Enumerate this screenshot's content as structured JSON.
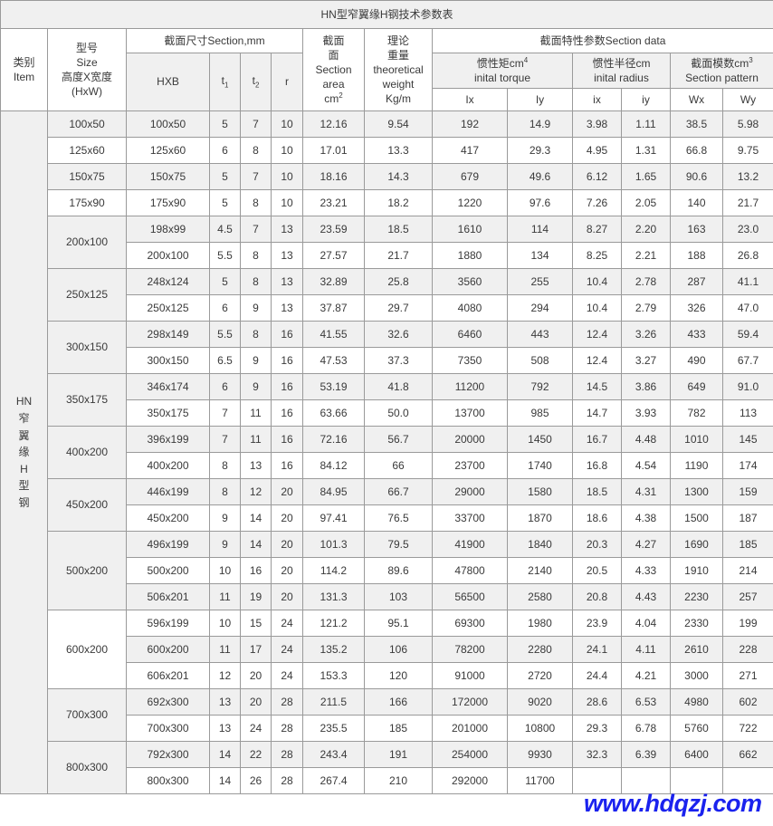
{
  "title": "HN型窄翼缘H钢技术参数表",
  "watermark": "www.hdqzj.com",
  "header": {
    "item_cn": "类别",
    "item_en": "Item",
    "size_cn": "型号",
    "size_en": "Size",
    "size_cn2": "高度X宽度",
    "size_en2": "(HxW)",
    "section_dims": "截面尺寸Section,mm",
    "hxb": "HXB",
    "t1_base": "t",
    "t1_sub": "1",
    "t2_base": "t",
    "t2_sub": "2",
    "r": "r",
    "area_l1": "截面",
    "area_l2": "面",
    "area_l3": "Section",
    "area_l4": "area",
    "area_l5_base": "cm",
    "area_l5_sup": "2",
    "weight_l1": "理论",
    "weight_l2": "重量",
    "weight_l3": "theoretical",
    "weight_l4": "weight",
    "weight_l5": "Kg/m",
    "section_data": "截面特性参数Section data",
    "torque_cn_base": "惯性矩cm",
    "torque_cn_sup": "4",
    "torque_en": "inital torque",
    "radius_cn": "惯性半径cm",
    "radius_en": "inital radius",
    "pattern_cn_base": "截面模数cm",
    "pattern_cn_sup": "3",
    "pattern_en": "Section pattern",
    "ix_head": "Ix",
    "iy_head": "Iy",
    "ix_r_head": "ix",
    "iy_r_head": "iy",
    "wx_head": "Wx",
    "wy_head": "Wy"
  },
  "category_label": [
    "HN",
    "窄",
    "翼",
    "缘",
    "H",
    "型",
    "钢"
  ],
  "colors": {
    "weight_red": "#ff2a1c",
    "watermark_blue": "#1a22ee",
    "header_gray": "#f0f0f0",
    "border": "#9a9a9a"
  },
  "chart_data": {
    "type": "table",
    "title": "HN型窄翼缘H钢技术参数表",
    "columns": [
      "类别Item",
      "型号Size 高度X宽度(HxW)",
      "HXB",
      "t1",
      "t2",
      "r",
      "Section area cm2",
      "theoretical weight Kg/m",
      "Ix",
      "Iy",
      "ix",
      "iy",
      "Wx",
      "Wy"
    ],
    "groups": [
      {
        "size": "100x50",
        "rowspan": 1
      },
      {
        "size": "125x60",
        "rowspan": 1
      },
      {
        "size": "150x75",
        "rowspan": 1
      },
      {
        "size": "175x90",
        "rowspan": 1
      },
      {
        "size": "200x100",
        "rowspan": 2
      },
      {
        "size": "250x125",
        "rowspan": 2
      },
      {
        "size": "300x150",
        "rowspan": 2
      },
      {
        "size": "350x175",
        "rowspan": 2
      },
      {
        "size": "400x200",
        "rowspan": 2
      },
      {
        "size": "450x200",
        "rowspan": 2
      },
      {
        "size": "500x200",
        "rowspan": 3
      },
      {
        "size": "600x200",
        "rowspan": 3
      },
      {
        "size": "700x300",
        "rowspan": 2
      },
      {
        "size": "800x300",
        "rowspan": 2
      }
    ],
    "rows": [
      {
        "hxb": "100x50",
        "t1": "5",
        "t2": "7",
        "r": "10",
        "area": "12.16",
        "weight": "9.54",
        "Ix": "192",
        "Iy": "14.9",
        "ix": "3.98",
        "iy": "1.11",
        "Wx": "38.5",
        "Wy": "5.98"
      },
      {
        "hxb": "125x60",
        "t1": "6",
        "t2": "8",
        "r": "10",
        "area": "17.01",
        "weight": "13.3",
        "Ix": "417",
        "Iy": "29.3",
        "ix": "4.95",
        "iy": "1.31",
        "Wx": "66.8",
        "Wy": "9.75"
      },
      {
        "hxb": "150x75",
        "t1": "5",
        "t2": "7",
        "r": "10",
        "area": "18.16",
        "weight": "14.3",
        "Ix": "679",
        "Iy": "49.6",
        "ix": "6.12",
        "iy": "1.65",
        "Wx": "90.6",
        "Wy": "13.2"
      },
      {
        "hxb": "175x90",
        "t1": "5",
        "t2": "8",
        "r": "10",
        "area": "23.21",
        "weight": "18.2",
        "Ix": "1220",
        "Iy": "97.6",
        "ix": "7.26",
        "iy": "2.05",
        "Wx": "140",
        "Wy": "21.7"
      },
      {
        "hxb": "198x99",
        "t1": "4.5",
        "t2": "7",
        "r": "13",
        "area": "23.59",
        "weight": "18.5",
        "Ix": "1610",
        "Iy": "114",
        "ix": "8.27",
        "iy": "2.20",
        "Wx": "163",
        "Wy": "23.0"
      },
      {
        "hxb": "200x100",
        "t1": "5.5",
        "t2": "8",
        "r": "13",
        "area": "27.57",
        "weight": "21.7",
        "Ix": "1880",
        "Iy": "134",
        "ix": "8.25",
        "iy": "2.21",
        "Wx": "188",
        "Wy": "26.8"
      },
      {
        "hxb": "248x124",
        "t1": "5",
        "t2": "8",
        "r": "13",
        "area": "32.89",
        "weight": "25.8",
        "Ix": "3560",
        "Iy": "255",
        "ix": "10.4",
        "iy": "2.78",
        "Wx": "287",
        "Wy": "41.1"
      },
      {
        "hxb": "250x125",
        "t1": "6",
        "t2": "9",
        "r": "13",
        "area": "37.87",
        "weight": "29.7",
        "Ix": "4080",
        "Iy": "294",
        "ix": "10.4",
        "iy": "2.79",
        "Wx": "326",
        "Wy": "47.0"
      },
      {
        "hxb": "298x149",
        "t1": "5.5",
        "t2": "8",
        "r": "16",
        "area": "41.55",
        "weight": "32.6",
        "Ix": "6460",
        "Iy": "443",
        "ix": "12.4",
        "iy": "3.26",
        "Wx": "433",
        "Wy": "59.4"
      },
      {
        "hxb": "300x150",
        "t1": "6.5",
        "t2": "9",
        "r": "16",
        "area": "47.53",
        "weight": "37.3",
        "Ix": "7350",
        "Iy": "508",
        "ix": "12.4",
        "iy": "3.27",
        "Wx": "490",
        "Wy": "67.7"
      },
      {
        "hxb": "346x174",
        "t1": "6",
        "t2": "9",
        "r": "16",
        "area": "53.19",
        "weight": "41.8",
        "Ix": "11200",
        "Iy": "792",
        "ix": "14.5",
        "iy": "3.86",
        "Wx": "649",
        "Wy": "91.0"
      },
      {
        "hxb": "350x175",
        "t1": "7",
        "t2": "11",
        "r": "16",
        "area": "63.66",
        "weight": "50.0",
        "Ix": "13700",
        "Iy": "985",
        "ix": "14.7",
        "iy": "3.93",
        "Wx": "782",
        "Wy": "113"
      },
      {
        "hxb": "396x199",
        "t1": "7",
        "t2": "11",
        "r": "16",
        "area": "72.16",
        "weight": "56.7",
        "Ix": "20000",
        "Iy": "1450",
        "ix": "16.7",
        "iy": "4.48",
        "Wx": "1010",
        "Wy": "145"
      },
      {
        "hxb": "400x200",
        "t1": "8",
        "t2": "13",
        "r": "16",
        "area": "84.12",
        "weight": "66",
        "Ix": "23700",
        "Iy": "1740",
        "ix": "16.8",
        "iy": "4.54",
        "Wx": "1190",
        "Wy": "174"
      },
      {
        "hxb": "446x199",
        "t1": "8",
        "t2": "12",
        "r": "20",
        "area": "84.95",
        "weight": "66.7",
        "Ix": "29000",
        "Iy": "1580",
        "ix": "18.5",
        "iy": "4.31",
        "Wx": "1300",
        "Wy": "159"
      },
      {
        "hxb": "450x200",
        "t1": "9",
        "t2": "14",
        "r": "20",
        "area": "97.41",
        "weight": "76.5",
        "Ix": "33700",
        "Iy": "1870",
        "ix": "18.6",
        "iy": "4.38",
        "Wx": "1500",
        "Wy": "187"
      },
      {
        "hxb": "496x199",
        "t1": "9",
        "t2": "14",
        "r": "20",
        "area": "101.3",
        "weight": "79.5",
        "Ix": "41900",
        "Iy": "1840",
        "ix": "20.3",
        "iy": "4.27",
        "Wx": "1690",
        "Wy": "185"
      },
      {
        "hxb": "500x200",
        "t1": "10",
        "t2": "16",
        "r": "20",
        "area": "114.2",
        "weight": "89.6",
        "Ix": "47800",
        "Iy": "2140",
        "ix": "20.5",
        "iy": "4.33",
        "Wx": "1910",
        "Wy": "214"
      },
      {
        "hxb": "506x201",
        "t1": "11",
        "t2": "19",
        "r": "20",
        "area": "131.3",
        "weight": "103",
        "Ix": "56500",
        "Iy": "2580",
        "ix": "20.8",
        "iy": "4.43",
        "Wx": "2230",
        "Wy": "257"
      },
      {
        "hxb": "596x199",
        "t1": "10",
        "t2": "15",
        "r": "24",
        "area": "121.2",
        "weight": "95.1",
        "Ix": "69300",
        "Iy": "1980",
        "ix": "23.9",
        "iy": "4.04",
        "Wx": "2330",
        "Wy": "199"
      },
      {
        "hxb": "600x200",
        "t1": "11",
        "t2": "17",
        "r": "24",
        "area": "135.2",
        "weight": "106",
        "Ix": "78200",
        "Iy": "2280",
        "ix": "24.1",
        "iy": "4.11",
        "Wx": "2610",
        "Wy": "228"
      },
      {
        "hxb": "606x201",
        "t1": "12",
        "t2": "20",
        "r": "24",
        "area": "153.3",
        "weight": "120",
        "Ix": "91000",
        "Iy": "2720",
        "ix": "24.4",
        "iy": "4.21",
        "Wx": "3000",
        "Wy": "271"
      },
      {
        "hxb": "692x300",
        "t1": "13",
        "t2": "20",
        "r": "28",
        "area": "211.5",
        "weight": "166",
        "Ix": "172000",
        "Iy": "9020",
        "ix": "28.6",
        "iy": "6.53",
        "Wx": "4980",
        "Wy": "602"
      },
      {
        "hxb": "700x300",
        "t1": "13",
        "t2": "24",
        "r": "28",
        "area": "235.5",
        "weight": "185",
        "Ix": "201000",
        "Iy": "10800",
        "ix": "29.3",
        "iy": "6.78",
        "Wx": "5760",
        "Wy": "722"
      },
      {
        "hxb": "792x300",
        "t1": "14",
        "t2": "22",
        "r": "28",
        "area": "243.4",
        "weight": "191",
        "Ix": "254000",
        "Iy": "9930",
        "ix": "32.3",
        "iy": "6.39",
        "Wx": "6400",
        "Wy": "662"
      },
      {
        "hxb": "800x300",
        "t1": "14",
        "t2": "26",
        "r": "28",
        "area": "267.4",
        "weight": "210",
        "Ix": "292000",
        "Iy": "11700",
        "ix": "",
        "iy": "",
        "Wx": "",
        "Wy": ""
      }
    ]
  }
}
